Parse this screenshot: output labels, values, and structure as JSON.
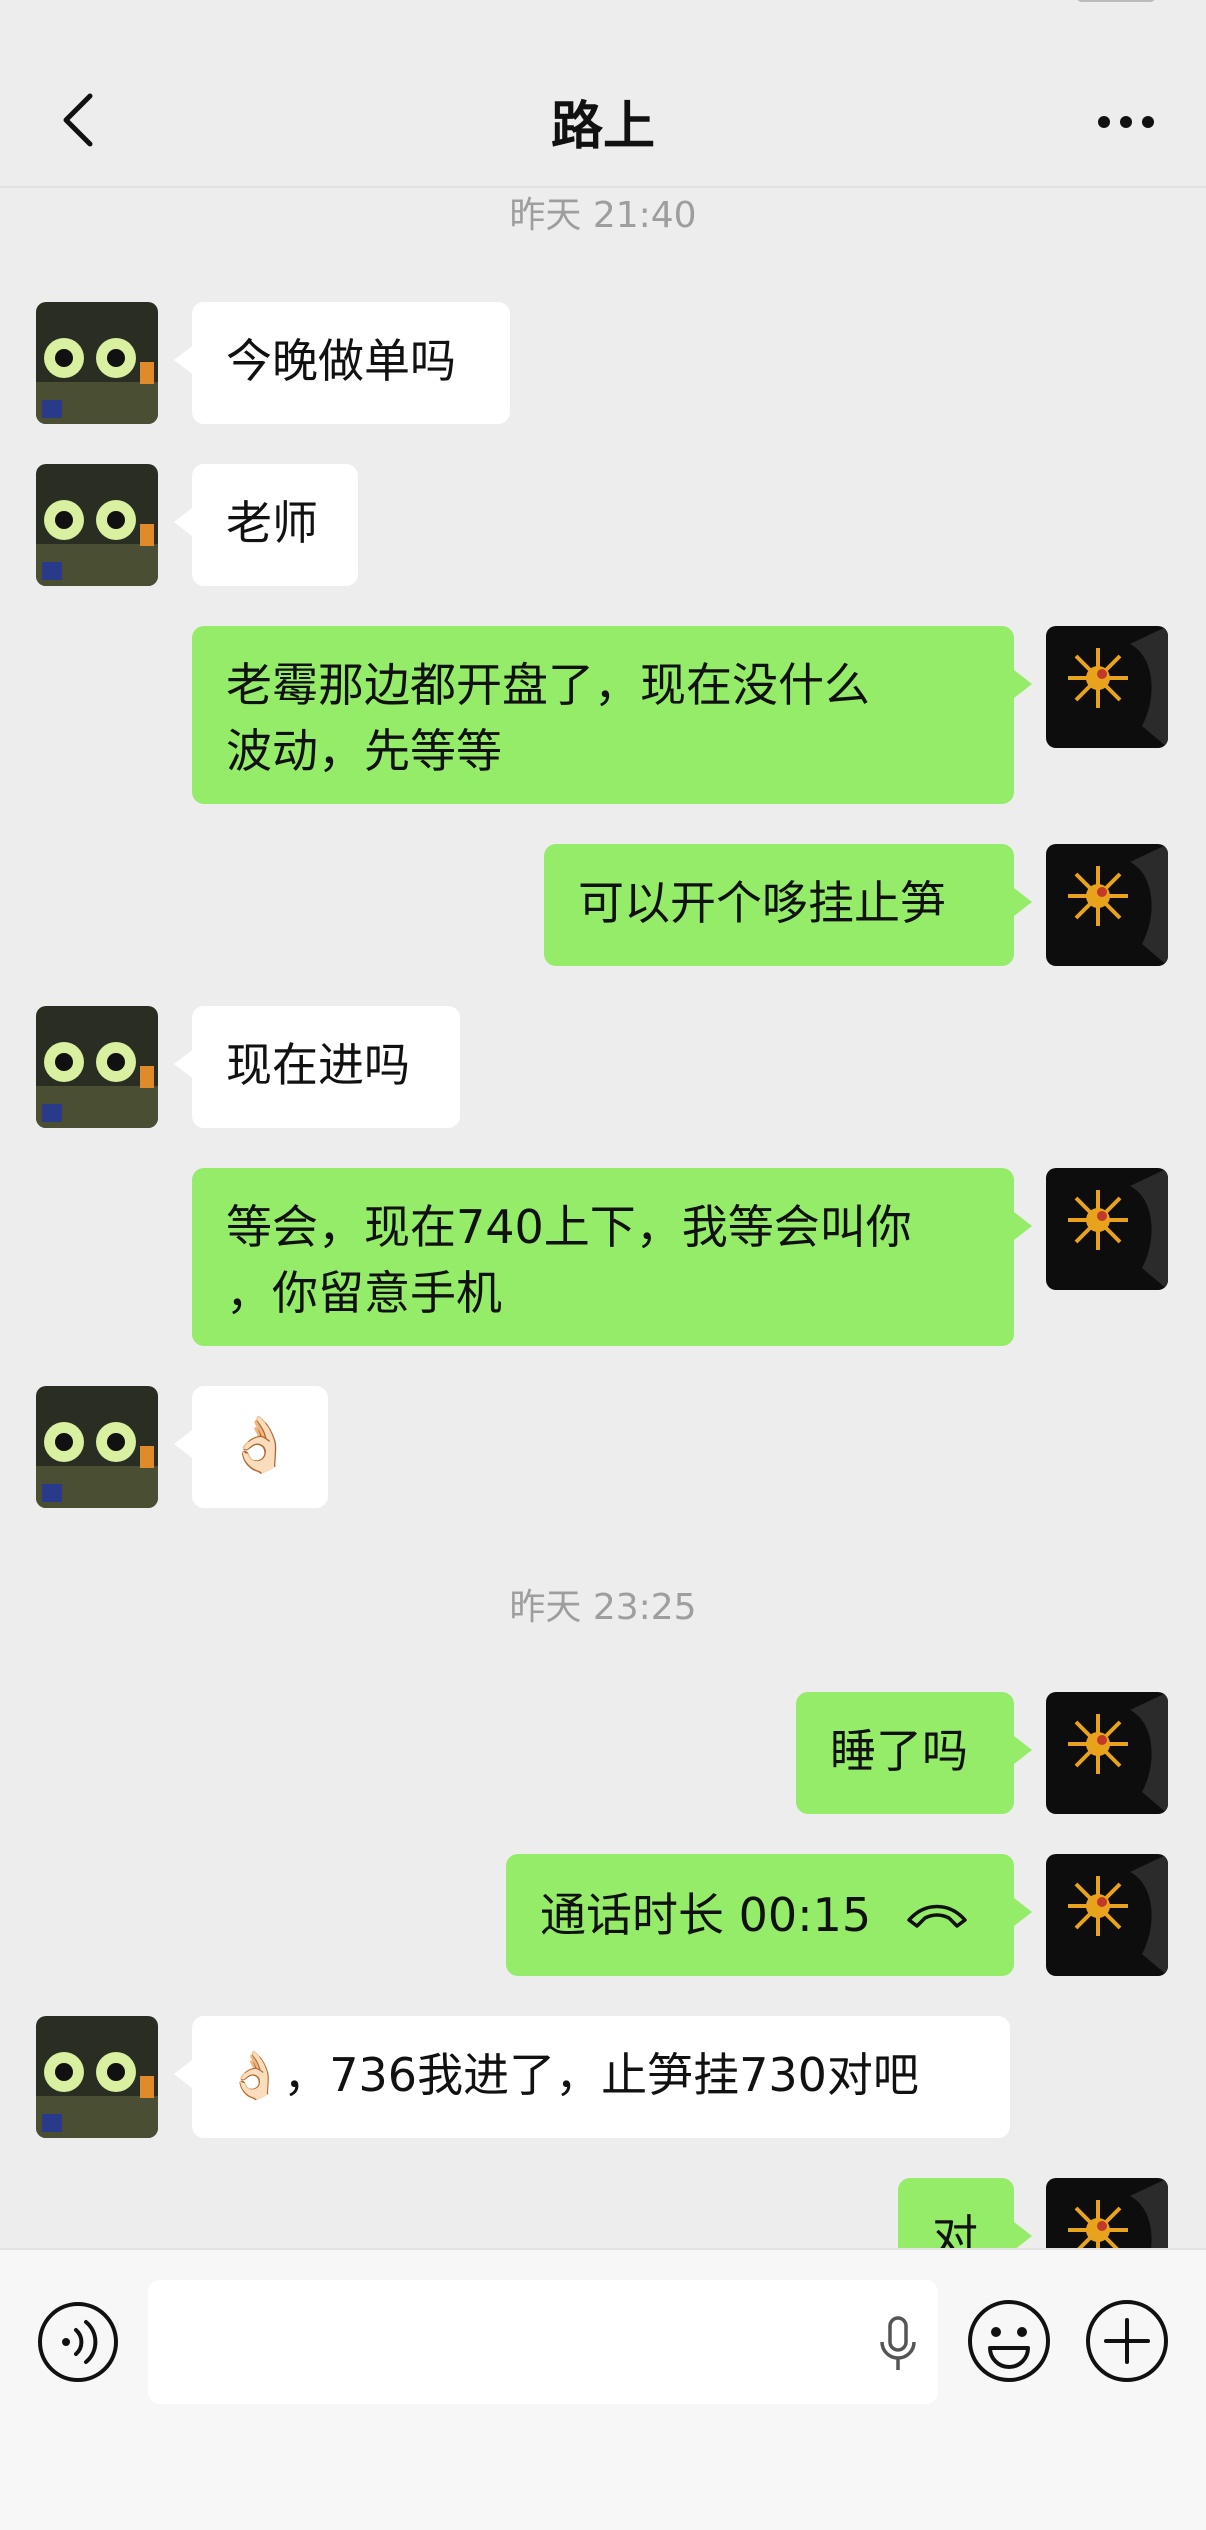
{
  "header": {
    "title": "路上"
  },
  "messages": [
    {
      "side": "timestamp",
      "text": "昨天 21:40"
    },
    {
      "side": "left",
      "text": "今晚做单吗"
    },
    {
      "side": "left",
      "text": "老师"
    },
    {
      "side": "right",
      "text": "老霉那边都开盘了，现在没什么\n波动，先等等"
    },
    {
      "side": "right",
      "text": "可以开个哆挂止笋"
    },
    {
      "side": "left",
      "text": "现在进吗"
    },
    {
      "side": "right",
      "text": "等会，现在740上下，我等会叫你\n，你留意手机"
    },
    {
      "side": "left",
      "text": "👌🏻"
    },
    {
      "side": "timestamp",
      "text": "昨天 23:25"
    },
    {
      "side": "right",
      "text": "睡了吗"
    },
    {
      "side": "right",
      "text": "通话时长 00:15",
      "icon": "phone-hangup-icon"
    },
    {
      "side": "left",
      "text": "👌🏻，736我进了，止笋挂730对吧"
    },
    {
      "side": "right",
      "text": "对"
    }
  ],
  "icons": {
    "back": "chevron-left-icon",
    "more": "more-dots-icon",
    "voice": "voice-input-icon",
    "mic": "microphone-icon",
    "emoji": "emoji-icon",
    "plus": "plus-icon"
  },
  "colors": {
    "sent_bubble": "#95ec69",
    "received_bubble": "#ffffff",
    "background": "#ededed"
  }
}
